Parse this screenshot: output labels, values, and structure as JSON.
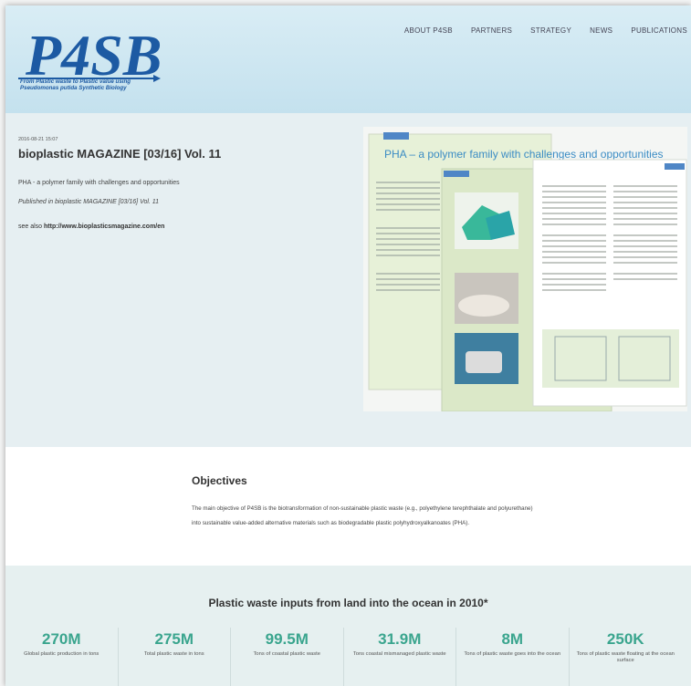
{
  "logo": {
    "text": "P4SB",
    "tagline_line1": "From Plastic waste to Plastic value using",
    "tagline_line2": "Pseudomonas putida Synthetic Biology"
  },
  "nav": [
    "ABOUT P4SB",
    "PARTNERS",
    "STRATEGY",
    "NEWS",
    "PUBLICATIONS"
  ],
  "article": {
    "date": "2016-08-21 15:07",
    "title": "bioplastic MAGAZINE [03/16] Vol. 11",
    "subtitle": "PHA - a polymer family with challenges and opportunities",
    "published": "Published in bioplastic MAGAZINE [03/16] Vol. 11",
    "see_also_label": "see also",
    "see_also_link": "http://www.bioplasticsmagazine.com/en",
    "magazine_heading": "PHA – a polymer family with challenges and opportunities"
  },
  "objectives": {
    "title": "Objectives",
    "text": "The main objective of P4SB is the biotransformation of non-sustainable plastic waste (e.g., polyethylene terephthalate and polyurethane) into sustainable value-added alternative materials such as biodegradable plastic polyhydroxyalkanoates (PHA)."
  },
  "stats": {
    "title": "Plastic waste inputs from land into the ocean in 2010*",
    "items": [
      {
        "value": "270M",
        "label": "Global plastic production in tons"
      },
      {
        "value": "275M",
        "label": "Total plastic waste in tons"
      },
      {
        "value": "99.5M",
        "label": "Tons of coastal plastic waste"
      },
      {
        "value": "31.9M",
        "label": "Tons coastal mismanaged plastic waste"
      },
      {
        "value": "8M",
        "label": "Tons of plastic waste goes into the ocean"
      },
      {
        "value": "250K",
        "label": "Tons of plastic waste floating at the ocean surface"
      }
    ]
  },
  "colors": {
    "accent": "#3aa58e",
    "logo_blue": "#1d5aa3",
    "header_bg": "#cfe7f1"
  }
}
